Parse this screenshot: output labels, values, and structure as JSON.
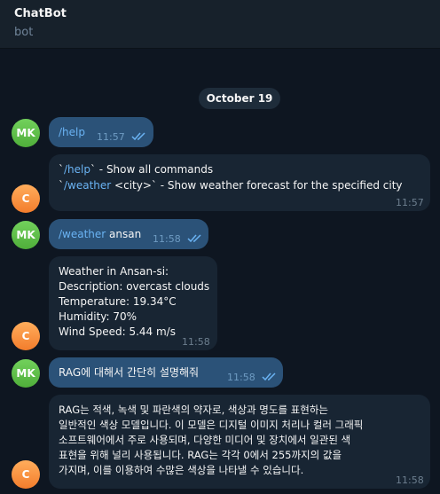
{
  "header": {
    "title": "ChatBot",
    "subtitle": "bot"
  },
  "date_label": "October 19",
  "messages": [
    {
      "avatar": "MK",
      "cmd": "/help",
      "time": "11:57"
    },
    {
      "avatar": "C",
      "line1_pre": "`",
      "line1_cmd": "/help",
      "line1_post": "` - Show all commands",
      "line2_pre": "`",
      "line2_cmd": "/weather",
      "line2_post": " <city>` - Show weather forecast for the specified city",
      "time": "11:57"
    },
    {
      "avatar": "MK",
      "cmd": "/weather",
      "arg": " ansan",
      "time": "11:58"
    },
    {
      "avatar": "C",
      "lines": [
        "Weather in Ansan-si:",
        "Description: overcast clouds",
        "Temperature: 19.34°C",
        "Humidity: 70%",
        "Wind Speed: 5.44 m/s"
      ],
      "time": "11:58"
    },
    {
      "avatar": "MK",
      "text": "RAG에 대해서 간단히 설명해줘",
      "time": "11:58"
    },
    {
      "avatar": "C",
      "lines": [
        "RAG는 적색, 녹색 및 파란색의 약자로, 색상과 명도를 표현하는",
        "일반적인 색상 모델입니다. 이 모델은 디지털 이미지 처리나 컬러 그래픽",
        "소프트웨어에서 주로 사용되며, 다양한 미디어 및 장치에서 일관된 색",
        "표현을 위해 널리 사용됩니다. RAG는 각각 0에서 255까지의 값을",
        "가지며, 이를 이용하여 수많은 색상을 나타낼 수 있습니다."
      ],
      "time": "11:58"
    }
  ],
  "colors": {
    "background": "#0e1621",
    "header": "#17212b",
    "outgoing": "#2b5278",
    "incoming": "#182533",
    "link": "#6ab3f3"
  }
}
